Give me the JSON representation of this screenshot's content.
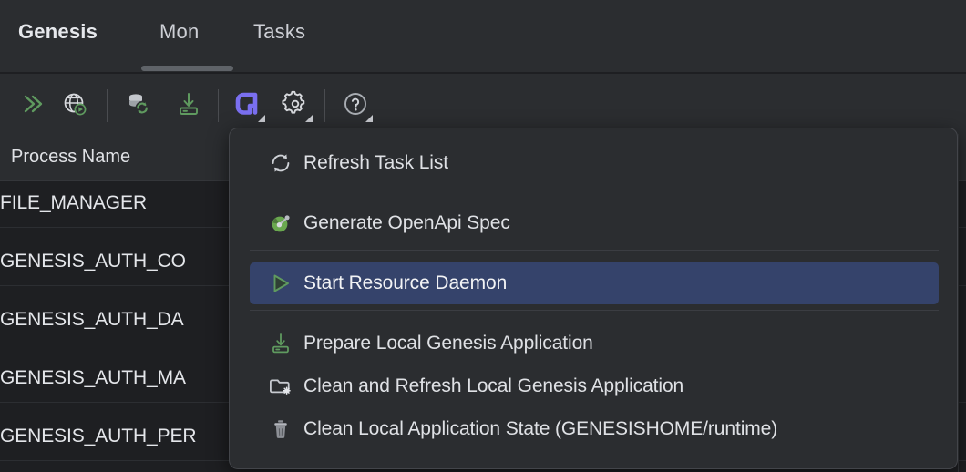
{
  "window": {
    "background": "#1e1f22",
    "panel_background": "#2b2d30",
    "accent_selection": "#35436b",
    "accent_purple": "#7a6ff0",
    "accent_green": "#5f9a5f"
  },
  "tabs": [
    {
      "label": "Genesis",
      "active": true
    },
    {
      "label": "Mon",
      "active": false
    },
    {
      "label": "Tasks",
      "active": false
    }
  ],
  "toolbar": {
    "buttons": [
      {
        "name": "run-all-icon",
        "icon": "double-chevron-right-icon",
        "has_dropdown": false
      },
      {
        "name": "run-web-icon",
        "icon": "globe-play-icon",
        "has_dropdown": false
      },
      {
        "name": "refresh-database-icon",
        "icon": "database-refresh-icon",
        "has_dropdown": false
      },
      {
        "name": "download-install-icon",
        "icon": "download-to-disk-icon",
        "has_dropdown": false
      },
      {
        "name": "genesis-tasks-icon",
        "icon": "genesis-logo-icon",
        "has_dropdown": true
      },
      {
        "name": "settings-icon",
        "icon": "gear-icon",
        "has_dropdown": true
      },
      {
        "name": "help-icon",
        "icon": "question-circle-icon",
        "has_dropdown": true
      }
    ]
  },
  "table": {
    "columns": [
      "Process Name"
    ],
    "rows": [
      {
        "process_name": "FILE_MANAGER"
      },
      {
        "process_name": "GENESIS_AUTH_CO"
      },
      {
        "process_name": "GENESIS_AUTH_DA"
      },
      {
        "process_name": "GENESIS_AUTH_MA"
      },
      {
        "process_name": "GENESIS_AUTH_PER"
      }
    ]
  },
  "menu": {
    "items": [
      {
        "label": "Refresh Task List",
        "icon": "refresh-circular-arrows-icon",
        "selected": false,
        "separator_after": true
      },
      {
        "label": "Generate OpenApi Spec",
        "icon": "openapi-swagger-icon",
        "selected": false,
        "separator_after": true
      },
      {
        "label": "Start Resource Daemon",
        "icon": "play-triangle-icon",
        "selected": true,
        "separator_after": true
      },
      {
        "label": "Prepare Local Genesis Application",
        "icon": "download-to-disk-icon",
        "selected": false,
        "separator_after": false
      },
      {
        "label": "Clean and Refresh Local Genesis Application",
        "icon": "folder-sparkle-icon",
        "selected": false,
        "separator_after": false
      },
      {
        "label": "Clean Local Application State (GENESISHOME/runtime)",
        "icon": "trash-can-icon",
        "selected": false,
        "separator_after": false
      }
    ]
  }
}
